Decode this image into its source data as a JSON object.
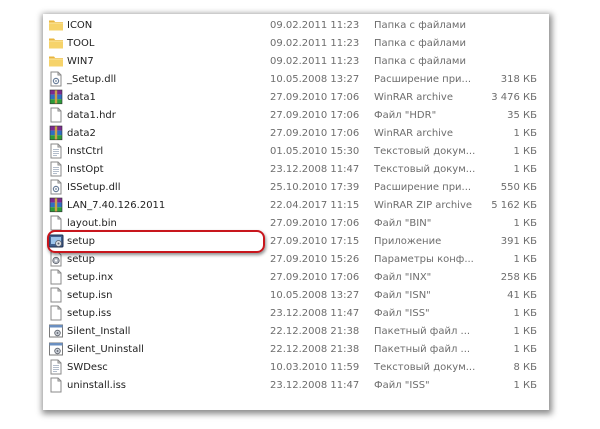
{
  "files": [
    {
      "name": "ICON",
      "date": "09.02.2011 11:23",
      "type": "Папка с файлами",
      "size": "",
      "icon": "folder-icon"
    },
    {
      "name": "TOOL",
      "date": "09.02.2011 11:23",
      "type": "Папка с файлами",
      "size": "",
      "icon": "folder-icon"
    },
    {
      "name": "WIN7",
      "date": "09.02.2011 11:23",
      "type": "Папка с файлами",
      "size": "",
      "icon": "folder-icon"
    },
    {
      "name": "_Setup.dll",
      "date": "10.05.2008 13:27",
      "type": "Расширение при...",
      "size": "318 КБ",
      "icon": "dll-file-icon"
    },
    {
      "name": "data1",
      "date": "27.09.2010 17:06",
      "type": "WinRAR archive",
      "size": "3 476 КБ",
      "icon": "winrar-archive-icon"
    },
    {
      "name": "data1.hdr",
      "date": "27.09.2010 17:06",
      "type": "Файл \"HDR\"",
      "size": "35 КБ",
      "icon": "generic-file-icon"
    },
    {
      "name": "data2",
      "date": "27.09.2010 17:06",
      "type": "WinRAR archive",
      "size": "1 КБ",
      "icon": "winrar-archive-icon"
    },
    {
      "name": "InstCtrl",
      "date": "01.05.2010 15:30",
      "type": "Текстовый докум...",
      "size": "1 КБ",
      "icon": "text-document-icon"
    },
    {
      "name": "InstOpt",
      "date": "23.12.2008 11:47",
      "type": "Текстовый докум...",
      "size": "1 КБ",
      "icon": "text-document-icon"
    },
    {
      "name": "ISSetup.dll",
      "date": "25.10.2010 17:39",
      "type": "Расширение при...",
      "size": "550 КБ",
      "icon": "dll-file-icon"
    },
    {
      "name": "LAN_7.40.126.2011",
      "date": "22.04.2017 11:15",
      "type": "WinRAR ZIP archive",
      "size": "5 162 КБ",
      "icon": "winrar-archive-icon"
    },
    {
      "name": "layout.bin",
      "date": "27.09.2010 17:06",
      "type": "Файл \"BIN\"",
      "size": "1 КБ",
      "icon": "generic-file-icon"
    },
    {
      "name": "setup",
      "date": "27.09.2010 17:15",
      "type": "Приложение",
      "size": "391 КБ",
      "icon": "setup-application-icon"
    },
    {
      "name": "setup",
      "date": "27.09.2010 15:26",
      "type": "Параметры конф...",
      "size": "1 КБ",
      "icon": "config-settings-icon"
    },
    {
      "name": "setup.inx",
      "date": "27.09.2010 17:06",
      "type": "Файл \"INX\"",
      "size": "258 КБ",
      "icon": "generic-file-icon"
    },
    {
      "name": "setup.isn",
      "date": "10.05.2008 13:27",
      "type": "Файл \"ISN\"",
      "size": "41 КБ",
      "icon": "generic-file-icon"
    },
    {
      "name": "setup.iss",
      "date": "23.12.2008 11:47",
      "type": "Файл \"ISS\"",
      "size": "1 КБ",
      "icon": "generic-file-icon"
    },
    {
      "name": "Silent_Install",
      "date": "22.12.2008 21:38",
      "type": "Пакетный файл ...",
      "size": "1 КБ",
      "icon": "batch-file-icon"
    },
    {
      "name": "Silent_Uninstall",
      "date": "22.12.2008 21:38",
      "type": "Пакетный файл ...",
      "size": "1 КБ",
      "icon": "batch-file-icon"
    },
    {
      "name": "SWDesc",
      "date": "10.03.2010 11:59",
      "type": "Текстовый докум...",
      "size": "8 КБ",
      "icon": "text-document-icon"
    },
    {
      "name": "uninstall.iss",
      "date": "23.12.2008 11:47",
      "type": "Файл \"ISS\"",
      "size": "1 КБ",
      "icon": "generic-file-icon"
    }
  ],
  "highlighted_row": 12,
  "colors": {
    "highlight_border": "#c8161d",
    "folder": "#f3cd5f",
    "secondary_text": "#6d6d6d"
  }
}
